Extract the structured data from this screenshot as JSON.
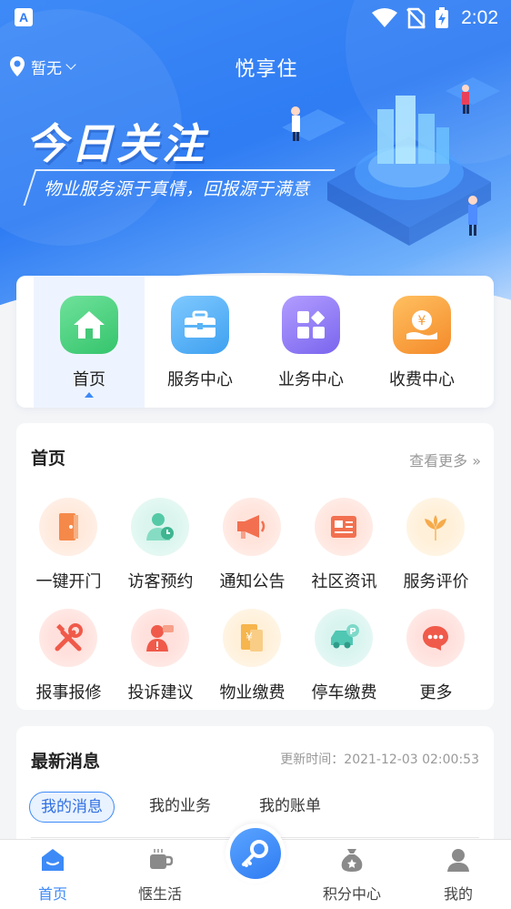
{
  "status_bar": {
    "time": "2:02",
    "notification_icon": "A"
  },
  "header": {
    "location": "暂无",
    "app_title": "悦享住"
  },
  "hero": {
    "headline": "今日关注",
    "slogan": "物业服务源于真情，回报源于满意"
  },
  "nav": {
    "items": [
      {
        "label": "首页",
        "icon": "home-icon",
        "color": "#4cd27a",
        "active": true
      },
      {
        "label": "服务中心",
        "icon": "toolbox-icon",
        "color": "#5cb3f5"
      },
      {
        "label": "业务中心",
        "icon": "apps-icon",
        "color": "#8e7cf4"
      },
      {
        "label": "收费中心",
        "icon": "yen-hand-icon",
        "color": "#f5a43d"
      }
    ]
  },
  "services": {
    "title": "首页",
    "more": "查看更多 »",
    "items": [
      {
        "label": "一键开门",
        "icon": "door-icon",
        "color": "#f5894a"
      },
      {
        "label": "访客预约",
        "icon": "visitor-icon",
        "color": "#55c9a6"
      },
      {
        "label": "通知公告",
        "icon": "megaphone-icon",
        "color": "#f2704f"
      },
      {
        "label": "社区资讯",
        "icon": "news-icon",
        "color": "#f2704f"
      },
      {
        "label": "服务评价",
        "icon": "flower-icon",
        "color": "#f6ab4c"
      },
      {
        "label": "报事报修",
        "icon": "tools-icon",
        "color": "#f05a4a"
      },
      {
        "label": "投诉建议",
        "icon": "complaint-icon",
        "color": "#f05a4a"
      },
      {
        "label": "物业缴费",
        "icon": "bill-icon",
        "color": "#f6b54d"
      },
      {
        "label": "停车缴费",
        "icon": "parking-icon",
        "color": "#4fc7b3"
      },
      {
        "label": "更多",
        "icon": "more-dots-icon",
        "color": "#f05a4a"
      }
    ]
  },
  "news": {
    "title": "最新消息",
    "update_time": "更新时间：2021-12-03 02:00:53",
    "tabs": [
      {
        "label": "我的消息",
        "active": true
      },
      {
        "label": "我的业务"
      },
      {
        "label": "我的账单"
      }
    ]
  },
  "tabbar": {
    "items": [
      {
        "label": "首页",
        "icon": "home-tab-icon",
        "active": true
      },
      {
        "label": "惬生活",
        "icon": "coffee-icon"
      },
      {
        "label": "积分中心",
        "icon": "points-bag-icon"
      },
      {
        "label": "我的",
        "icon": "user-icon"
      }
    ],
    "center_icon": "key-icon"
  },
  "colors": {
    "primary": "#3d8af7"
  }
}
